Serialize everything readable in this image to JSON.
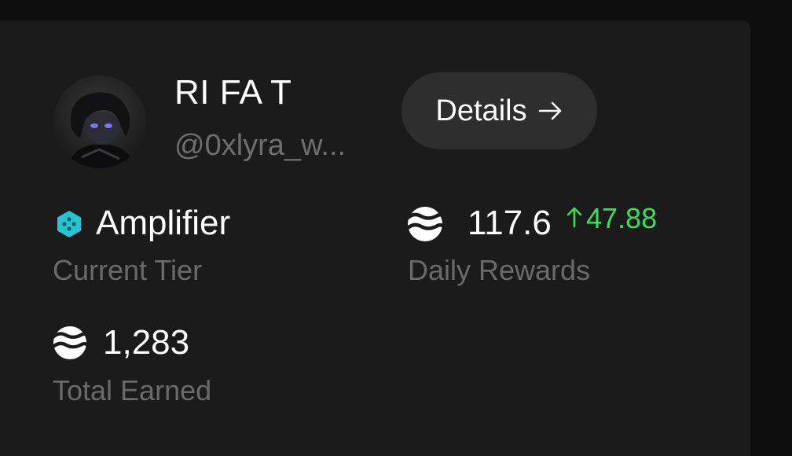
{
  "profile": {
    "name": "RI FA T",
    "handle": "@0xlyra_w..."
  },
  "details_button": {
    "label": "Details",
    "icon": "arrow-right-icon"
  },
  "tier": {
    "value": "Amplifier",
    "label": "Current Tier",
    "icon": "tier-hexagon-icon",
    "icon_color": "#27c3d2"
  },
  "daily_rewards": {
    "value": "117.6",
    "delta": "47.88",
    "delta_color": "#35e05a",
    "label": "Daily Rewards",
    "icon": "token-waves-icon"
  },
  "total_earned": {
    "value": "1,283",
    "label": "Total Earned",
    "icon": "token-waves-icon"
  }
}
